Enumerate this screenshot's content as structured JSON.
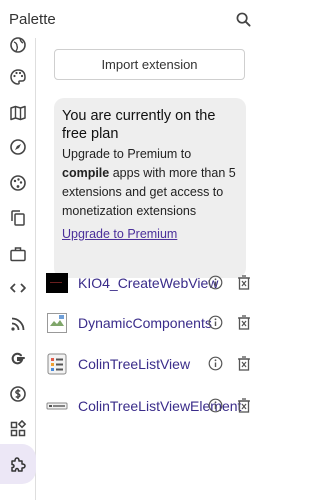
{
  "header": {
    "title": "Palette",
    "search_icon": "search-icon"
  },
  "rail": {
    "items": [
      {
        "icon": "world-icon"
      },
      {
        "icon": "palette-icon"
      },
      {
        "icon": "map-icon"
      },
      {
        "icon": "compass-icon"
      },
      {
        "icon": "palette-circle-icon"
      },
      {
        "icon": "copy-icon"
      },
      {
        "icon": "briefcase-icon"
      },
      {
        "icon": "code-icon"
      },
      {
        "icon": "rss-icon"
      },
      {
        "icon": "google-icon"
      },
      {
        "icon": "dollar-icon"
      },
      {
        "icon": "apps-icon"
      },
      {
        "icon": "puzzle-icon",
        "active": true
      }
    ],
    "active_color": "#ece7f6"
  },
  "main": {
    "import_label": "Import extension",
    "premium": {
      "title": "You are currently on the free plan",
      "body_pre": "Upgrade to Premium to ",
      "body_bold": "compile",
      "body_post": " apps with more than 5 extensions and get access to monetization extensions",
      "link": "Upgrade to Premium"
    },
    "extensions": [
      {
        "name": "KIO4_CreateWebView",
        "icon": "black-square-icon"
      },
      {
        "name": "DynamicComponents",
        "icon": "broken-image-icon"
      },
      {
        "name": "ColinTreeListView",
        "icon": "list-icon"
      },
      {
        "name": "ColinTreeListViewElement",
        "icon": "list-element-icon"
      }
    ]
  },
  "colors": {
    "link": "#4a2f9a",
    "ext_name": "#3a2c8a",
    "card_bg": "#eeeeee"
  }
}
